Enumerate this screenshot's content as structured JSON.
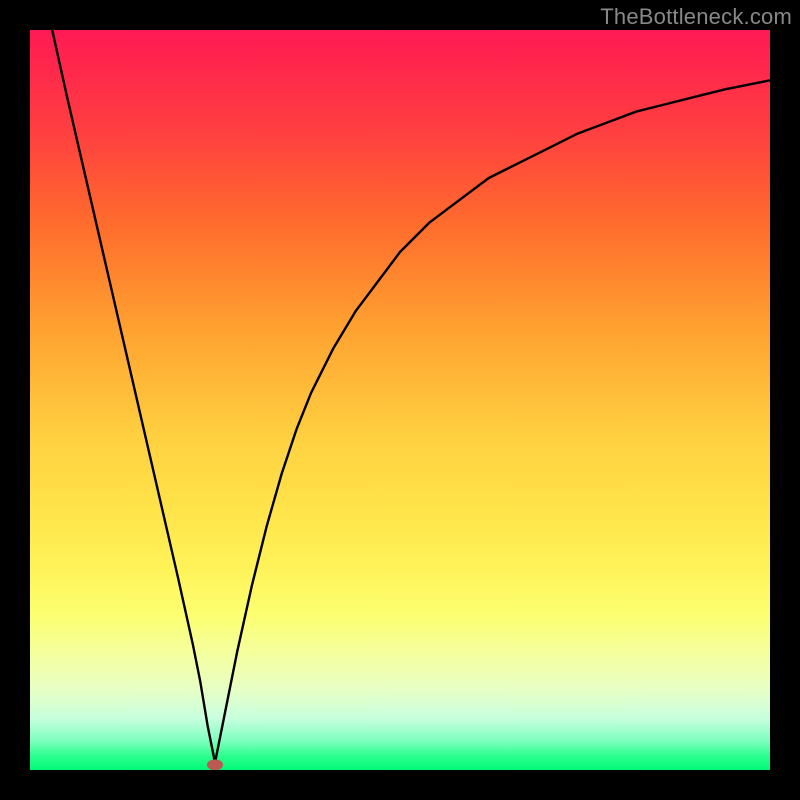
{
  "attribution": "TheBottleneck.com",
  "chart_data": {
    "type": "line",
    "title": "",
    "xlabel": "",
    "ylabel": "",
    "xlim": [
      0,
      100
    ],
    "ylim": [
      0,
      100
    ],
    "series": [
      {
        "name": "bottleneck-curve",
        "x": [
          3,
          5,
          8,
          11,
          14,
          17,
          20,
          22,
          23,
          24,
          25,
          26,
          28,
          30,
          32,
          34,
          36,
          38,
          41,
          44,
          47,
          50,
          54,
          58,
          62,
          66,
          70,
          74,
          78,
          82,
          86,
          90,
          94,
          98,
          100
        ],
        "y": [
          100,
          91,
          78,
          65,
          52,
          39,
          26,
          17,
          12,
          6,
          1,
          6,
          16,
          25,
          33,
          40,
          46,
          51,
          57,
          62,
          66,
          70,
          74,
          77,
          80,
          82,
          84,
          86,
          87.5,
          89,
          90,
          91,
          92,
          92.8,
          93.2
        ]
      }
    ],
    "marker": {
      "x": 25,
      "y": 0.7,
      "color": "#bb5a52"
    },
    "gradient_stops": [
      {
        "pct": 0,
        "color": "#ff1a55"
      },
      {
        "pct": 14,
        "color": "#ff4040"
      },
      {
        "pct": 40,
        "color": "#ffa030"
      },
      {
        "pct": 65,
        "color": "#ffe44a"
      },
      {
        "pct": 84,
        "color": "#f5ff9c"
      },
      {
        "pct": 96,
        "color": "#80ffc0"
      },
      {
        "pct": 100,
        "color": "#00f878"
      }
    ]
  }
}
